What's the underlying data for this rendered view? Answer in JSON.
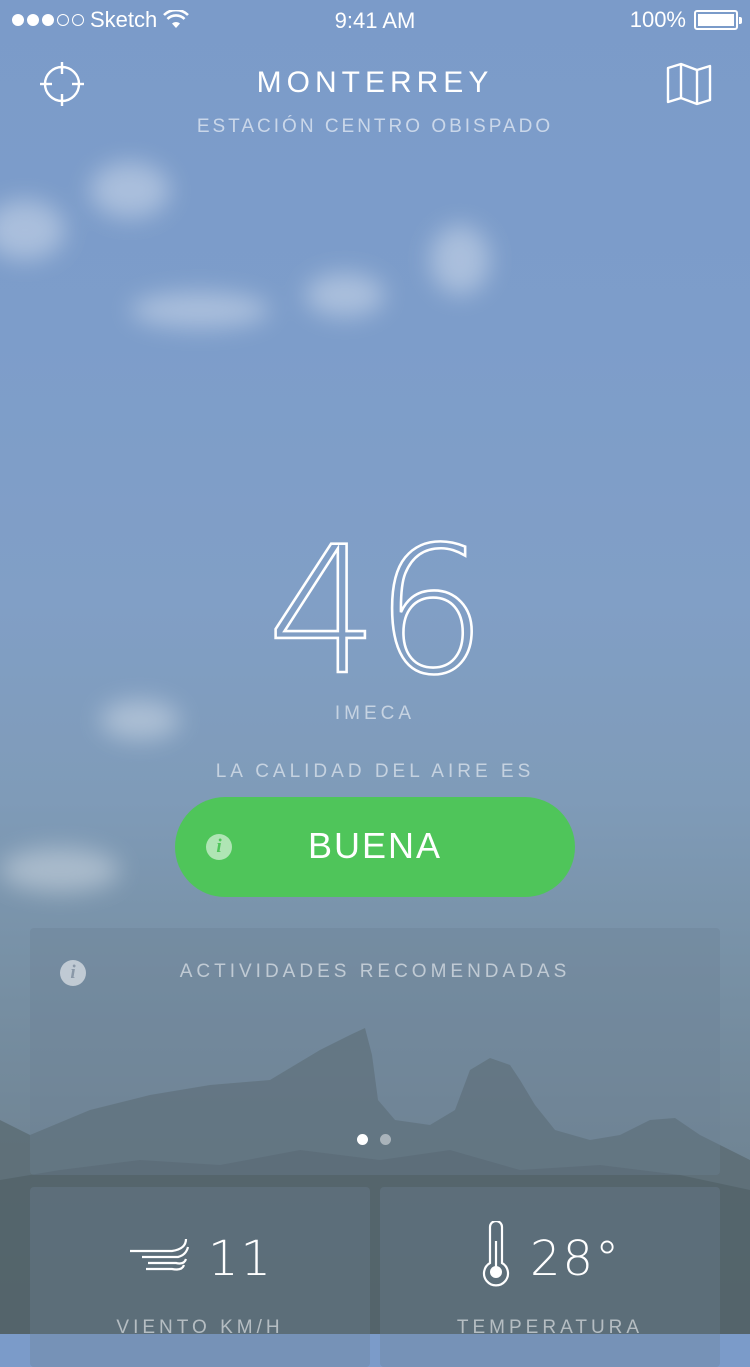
{
  "status_bar": {
    "carrier": "Sketch",
    "time": "9:41 AM",
    "battery": "100%",
    "signal_bars_filled": 3,
    "signal_bars_total": 5
  },
  "header": {
    "locate_icon": "crosshair-icon",
    "city": "MONTERREY",
    "station": "ESTACIÓN CENTRO OBISPADO",
    "map_icon": "map-icon"
  },
  "air_quality": {
    "value": "46",
    "unit": "IMECA",
    "label": "LA CALIDAD DEL AIRE ES",
    "status": "BUENA",
    "status_color": "#4fc55a",
    "info_icon": "info-icon"
  },
  "activities": {
    "title": "ACTIVIDADES RECOMENDADAS",
    "info_icon": "info-icon",
    "page_count": 2,
    "current_page": 1
  },
  "stats": {
    "wind": {
      "icon": "wind-icon",
      "value": "11",
      "label": "VIENTO KM/H"
    },
    "temperature": {
      "icon": "thermometer-icon",
      "value": "28°",
      "label": "TEMPERATURA"
    }
  }
}
